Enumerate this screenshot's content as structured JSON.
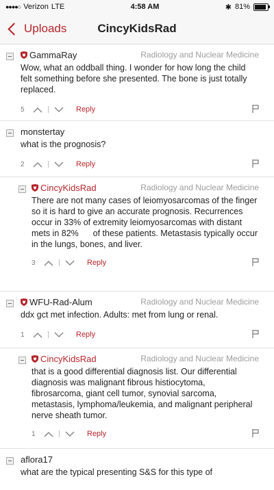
{
  "status": {
    "carrier": "Verizon",
    "network": "LTE",
    "time": "4:58 AM",
    "battery": "81%"
  },
  "nav": {
    "back_label": "Uploads",
    "title": "CincyKidsRad"
  },
  "colors": {
    "accent": "#b5252b"
  },
  "comments": [
    {
      "user": "GammaRay",
      "dept": "Radiology and Nuclear Medicine",
      "text": "Wow, what an oddball thing. I wonder for how long the child felt something before she presented. The bone is just totally replaced.",
      "score": "5",
      "reply": "Reply"
    },
    {
      "user": "monstertay",
      "dept": "",
      "text": "what is the prognosis?",
      "score": "2",
      "reply": "Reply"
    },
    {
      "user": "CincyKidsRad",
      "dept": "Radiology and Nuclear Medicine",
      "text": "There are not many cases of leiomyosarcomas of the finger so it is hard to give an accurate prognosis. Recurrences occur in 33% of extremity leiomyosarcomas with distant mets in 82%      of these patients. Metastasis typically occur in the lungs, bones, and liver.",
      "score": "3",
      "reply": "Reply"
    },
    {
      "user": "WFU-Rad-Alum",
      "dept": "Radiology and Nuclear Medicine",
      "text": "ddx gct met infection.  Adults:  met from lung or renal.",
      "score": "1",
      "reply": "Reply"
    },
    {
      "user": "CincyKidsRad",
      "dept": "Radiology and Nuclear Medicine",
      "text": "that is a good differential diagnosis list. Our differential diagnosis was malignant fibrous histiocytoma, fibrosarcoma, giant cell tumor, synovial sarcoma, metastasis, lymphoma/leukemia, and malignant peripheral nerve sheath tumor.",
      "score": "1",
      "reply": "Reply"
    },
    {
      "user": "aflora17",
      "dept": "",
      "text": "what are the typical presenting S&S for this type of",
      "score": "",
      "reply": ""
    }
  ]
}
